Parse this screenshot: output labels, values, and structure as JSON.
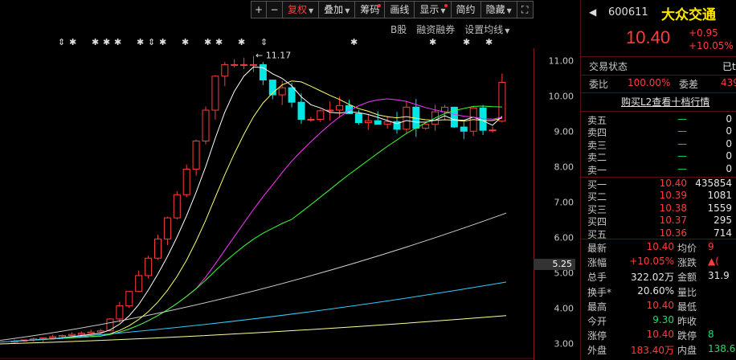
{
  "toolbar": {
    "plus": "+",
    "minus": "−",
    "fuquan": "复权",
    "diejia": "叠加",
    "chouma": "筹码",
    "huaxian": "画线",
    "xianshi": "显示",
    "jianyue": "简约",
    "yincang": "隐藏",
    "expand": "⛶"
  },
  "subbar": {
    "bgu": "B股",
    "rongzi": "融资融券",
    "shezhi": "设置均线"
  },
  "y_ticks": [
    "11.00",
    "10.00",
    "9.00",
    "8.00",
    "7.00",
    "6.00",
    "5.00",
    "4.00",
    "3.00"
  ],
  "current_price_marker": "5.25",
  "peak_label": "11.17",
  "colors": {
    "up": "#ff3b3b",
    "down": "#00e5e5",
    "ma5": "#ffffff",
    "ma10": "#ffff66",
    "ma20": "#ff33ff",
    "ma30": "#33ff33",
    "ma60": "#cccccc",
    "ma120": "#33ccff",
    "ma250": "#ffff99",
    "accent_name": "#ffe600",
    "green": "#19e069"
  },
  "quote": {
    "code": "600611",
    "name": "大众交通",
    "back_icon": "◀",
    "price": "10.40",
    "change": "+0.95",
    "change_pct": "+10.05%",
    "status_label": "交易状态",
    "status_value": "已t",
    "weibi_label": "委比",
    "weibi_value": "100.00%",
    "weicha_label": "委差",
    "weicha_value": "439",
    "l2_link": "购买L2查看十档行情",
    "asks": [
      {
        "label": "卖五",
        "price": "—",
        "vol": "0"
      },
      {
        "label": "卖四",
        "price": "—",
        "vol": "0"
      },
      {
        "label": "卖三",
        "price": "—",
        "vol": "0"
      },
      {
        "label": "卖二",
        "price": "—",
        "vol": "0"
      },
      {
        "label": "卖一",
        "price": "—",
        "vol": "0"
      }
    ],
    "bids": [
      {
        "label": "买一",
        "price": "10.40",
        "vol": "435854"
      },
      {
        "label": "买二",
        "price": "10.39",
        "vol": "1081"
      },
      {
        "label": "买三",
        "price": "10.38",
        "vol": "1559"
      },
      {
        "label": "买四",
        "price": "10.37",
        "vol": "295"
      },
      {
        "label": "买五",
        "price": "10.36",
        "vol": "714"
      }
    ],
    "stats": [
      {
        "l1": "最新",
        "v1": "10.40",
        "c1": "red",
        "l2": "均价",
        "v2": "9",
        "c2": "red"
      },
      {
        "l1": "涨幅",
        "v1": "+10.05%",
        "c1": "red",
        "l2": "涨跌",
        "v2": "▲(",
        "c2": "red"
      },
      {
        "l1": "总手",
        "v1": "322.02万",
        "c1": "white",
        "l2": "金额",
        "v2": "31.9",
        "c2": "white"
      },
      {
        "l1": "换手*",
        "v1": "20.60%",
        "c1": "white",
        "l2": "量比",
        "v2": "",
        "c2": "white"
      },
      {
        "l1": "最高",
        "v1": "10.40",
        "c1": "red",
        "l2": "最低",
        "v2": "",
        "c2": "red"
      },
      {
        "l1": "今开",
        "v1": "9.30",
        "c1": "green",
        "l2": "昨收",
        "v2": "",
        "c2": "white"
      },
      {
        "l1": "涨停",
        "v1": "10.40",
        "c1": "red",
        "l2": "跌停",
        "v2": "8",
        "c2": "green"
      },
      {
        "l1": "外盘",
        "v1": "183.40万",
        "c1": "red",
        "l2": "内盘",
        "v2": "138.6",
        "c2": "green"
      }
    ]
  }
}
